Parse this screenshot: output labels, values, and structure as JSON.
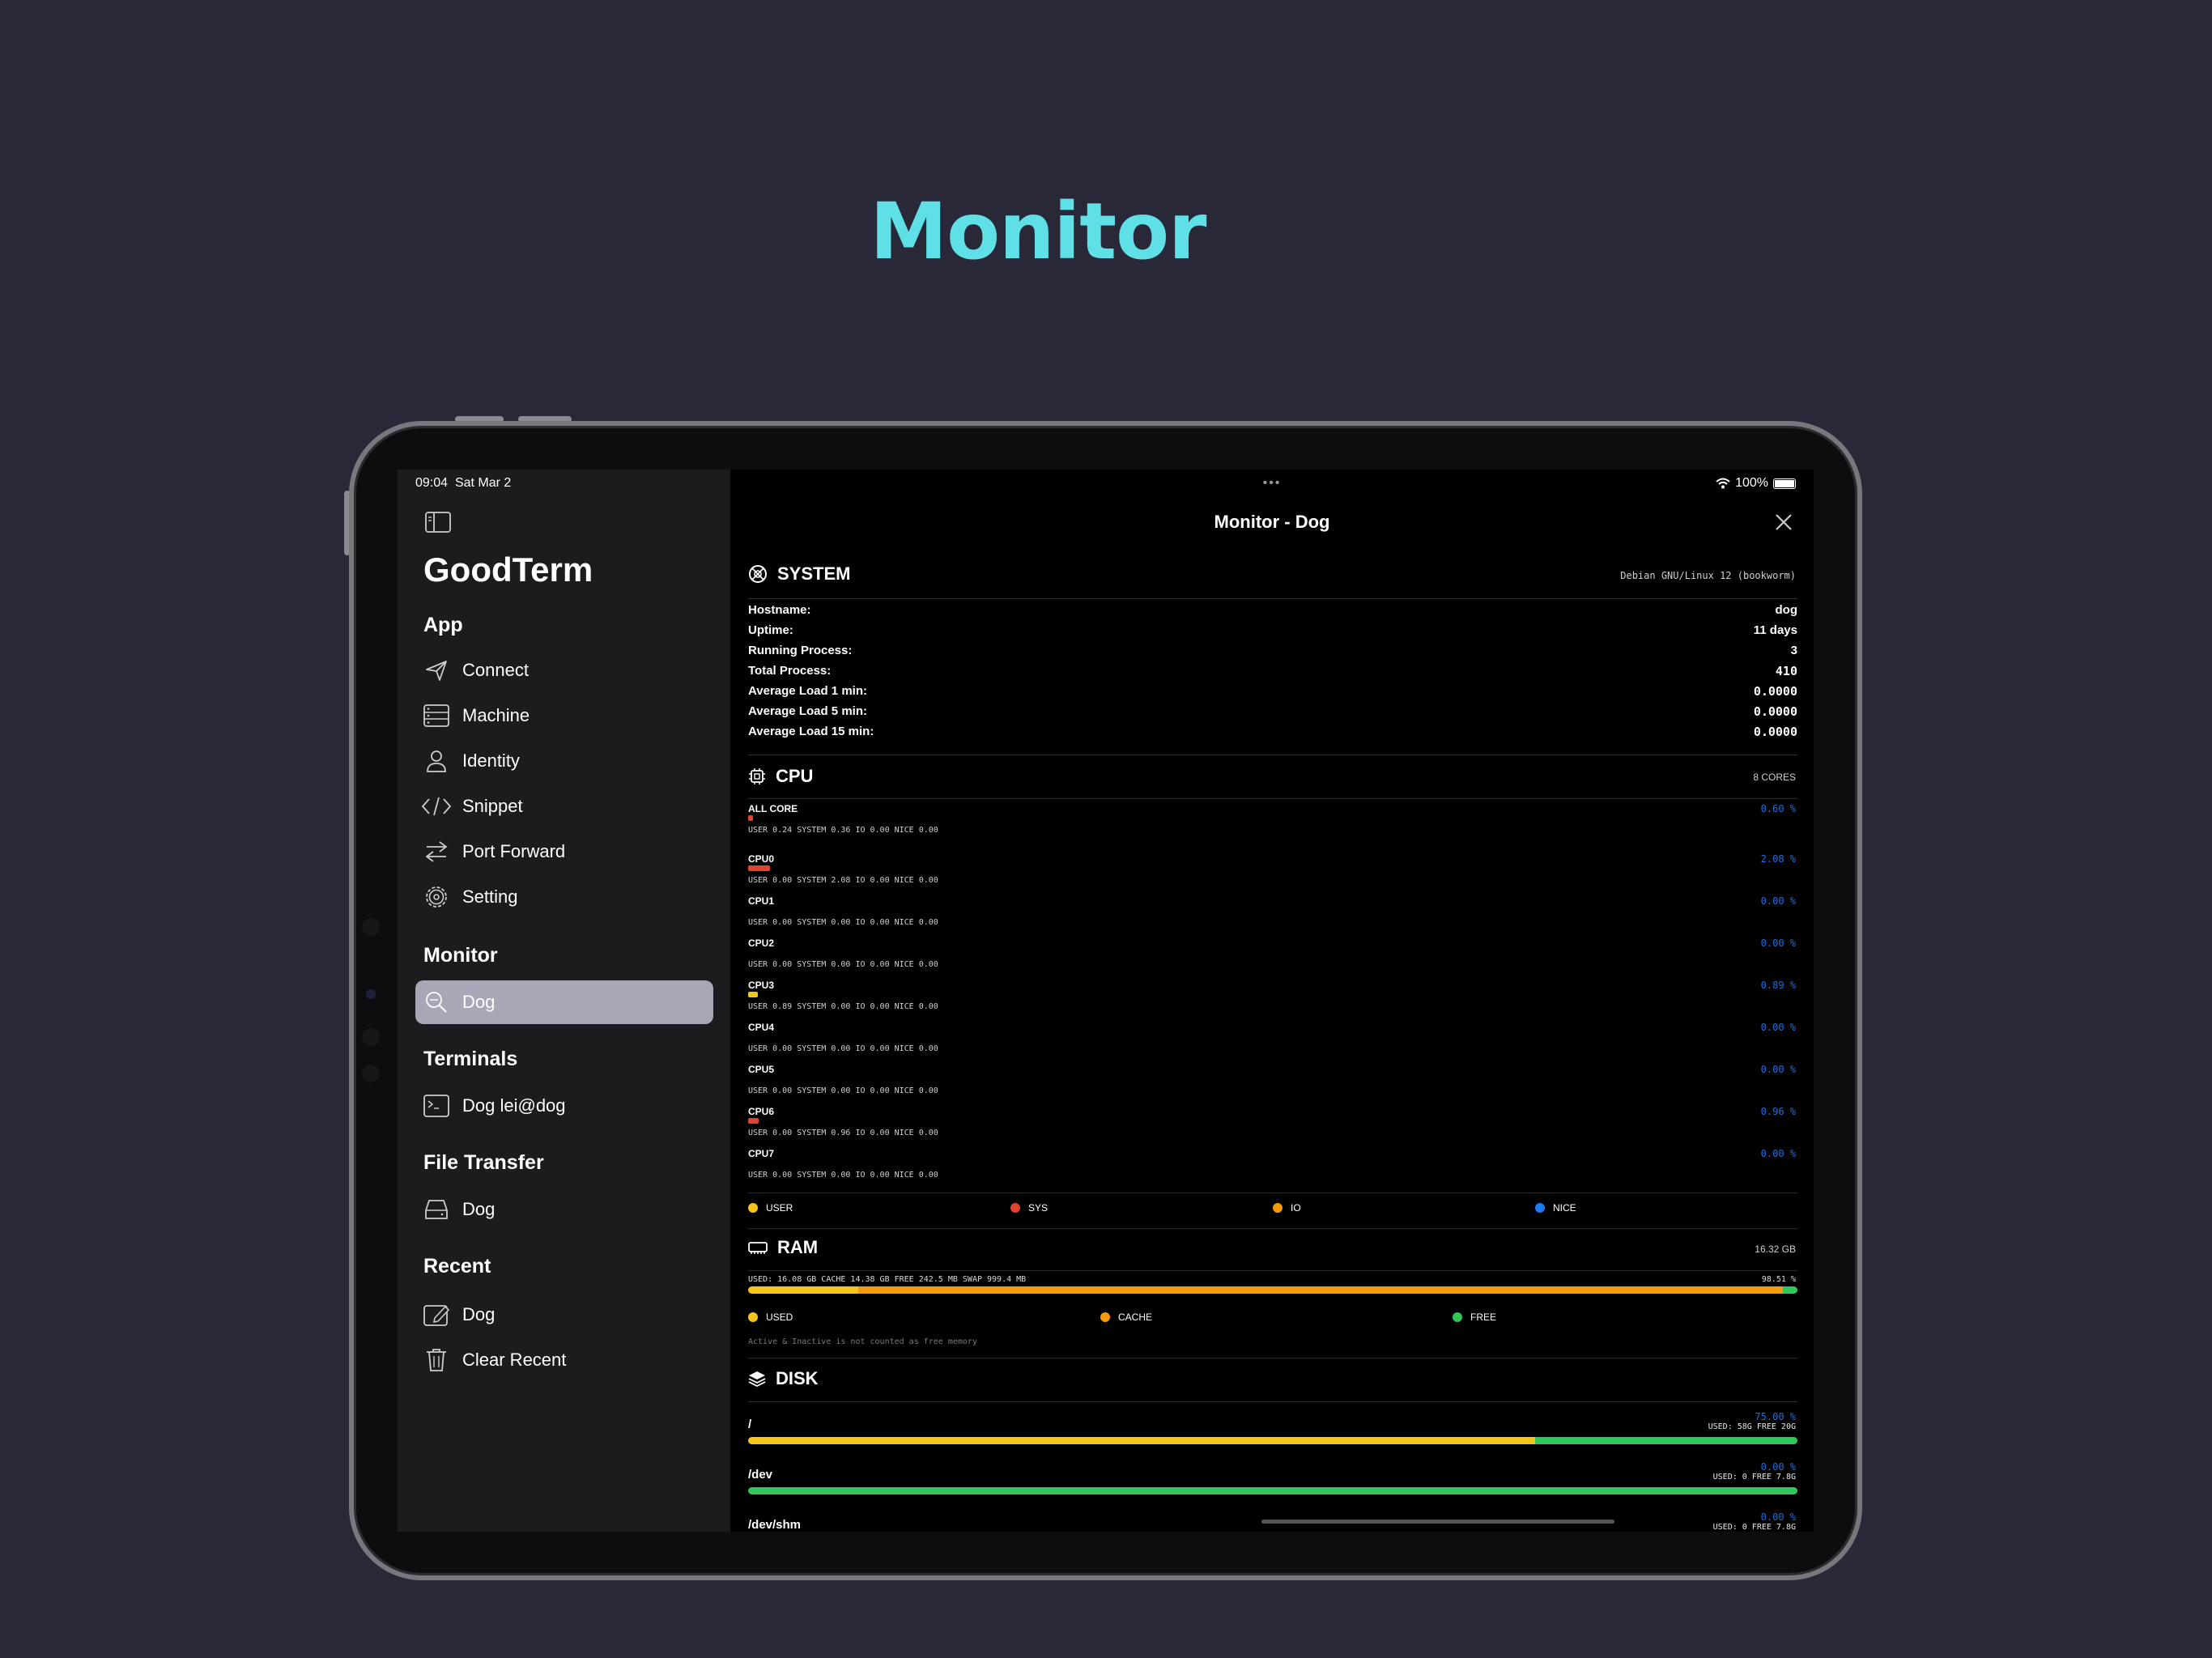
{
  "hero": {
    "title": "Monitor"
  },
  "status": {
    "time": "09:04",
    "date": "Sat Mar 2",
    "battery": "100%"
  },
  "sidebar": {
    "app_title": "GoodTerm",
    "sections": {
      "app": "App",
      "monitor": "Monitor",
      "terminals": "Terminals",
      "file_transfer": "File Transfer",
      "recent": "Recent"
    },
    "app_items": [
      {
        "label": "Connect",
        "icon": "paper-plane-icon"
      },
      {
        "label": "Machine",
        "icon": "server-icon"
      },
      {
        "label": "Identity",
        "icon": "person-icon"
      },
      {
        "label": "Snippet",
        "icon": "code-icon"
      },
      {
        "label": "Port Forward",
        "icon": "arrows-left-right-icon"
      },
      {
        "label": "Setting",
        "icon": "gear-icon"
      }
    ],
    "monitor_items": [
      {
        "label": "Dog",
        "icon": "magnifier-icon",
        "active": true
      }
    ],
    "terminal_items": [
      {
        "label": "Dog lei@dog",
        "icon": "terminal-icon"
      }
    ],
    "file_items": [
      {
        "label": "Dog",
        "icon": "hard-drive-icon"
      }
    ],
    "recent_items": [
      {
        "label": "Dog",
        "icon": "edit-icon"
      },
      {
        "label": "Clear Recent",
        "icon": "trash-icon"
      }
    ]
  },
  "main": {
    "dots": "•••",
    "title": "Monitor - Dog",
    "system": {
      "title": "SYSTEM",
      "os": "Debian GNU/Linux 12 (bookworm)",
      "rows": [
        {
          "k": "Hostname:",
          "v": "dog"
        },
        {
          "k": "Uptime:",
          "v": "11 days"
        },
        {
          "k": "Running Process:",
          "v": "3"
        },
        {
          "k": "Total Process:",
          "v": "410"
        },
        {
          "k": "Average Load 1 min:",
          "v": "0.0000"
        },
        {
          "k": "Average Load 5 min:",
          "v": "0.0000"
        },
        {
          "k": "Average Load 15 min:",
          "v": "0.0000"
        }
      ]
    },
    "cpu": {
      "title": "CPU",
      "cores": "8 CORES",
      "rows": [
        {
          "name": "ALL CORE",
          "pct": "0.60 %",
          "detail": "USER 0.24 SYSTEM 0.36 IO 0.00 NICE 0.00",
          "bar_color": "#e0442f",
          "bar_frac": 0.005
        },
        {
          "name": "CPU0",
          "pct": "2.08 %",
          "detail": "USER 0.00 SYSTEM 2.08 IO 0.00 NICE 0.00",
          "bar_color": "#e0442f",
          "bar_frac": 0.021
        },
        {
          "name": "CPU1",
          "pct": "0.00 %",
          "detail": "USER 0.00 SYSTEM 0.00 IO 0.00 NICE 0.00",
          "bar_color": "#e0442f",
          "bar_frac": 0
        },
        {
          "name": "CPU2",
          "pct": "0.00 %",
          "detail": "USER 0.00 SYSTEM 0.00 IO 0.00 NICE 0.00",
          "bar_color": "#e0442f",
          "bar_frac": 0
        },
        {
          "name": "CPU3",
          "pct": "0.89 %",
          "detail": "USER 0.89 SYSTEM 0.00 IO 0.00 NICE 0.00",
          "bar_color": "#f5c518",
          "bar_frac": 0.009
        },
        {
          "name": "CPU4",
          "pct": "0.00 %",
          "detail": "USER 0.00 SYSTEM 0.00 IO 0.00 NICE 0.00",
          "bar_color": "#e0442f",
          "bar_frac": 0
        },
        {
          "name": "CPU5",
          "pct": "0.00 %",
          "detail": "USER 0.00 SYSTEM 0.00 IO 0.00 NICE 0.00",
          "bar_color": "#e0442f",
          "bar_frac": 0
        },
        {
          "name": "CPU6",
          "pct": "0.96 %",
          "detail": "USER 0.00 SYSTEM 0.96 IO 0.00 NICE 0.00",
          "bar_color": "#e0442f",
          "bar_frac": 0.01
        },
        {
          "name": "CPU7",
          "pct": "0.00 %",
          "detail": "USER 0.00 SYSTEM 0.00 IO 0.00 NICE 0.00",
          "bar_color": "#e0442f",
          "bar_frac": 0
        }
      ],
      "legend": [
        {
          "label": "USER",
          "color": "#f5c518"
        },
        {
          "label": "SYS",
          "color": "#e0442f"
        },
        {
          "label": "IO",
          "color": "#f59a0b"
        },
        {
          "label": "NICE",
          "color": "#1a7cf0"
        }
      ]
    },
    "ram": {
      "title": "RAM",
      "total": "16.32 GB",
      "summary": "USED: 16.08 GB CACHE 14.38 GB FREE 242.5 MB SWAP 999.4 MB",
      "pct": "98.51 %",
      "used_frac": 0.105,
      "cache_frac": 0.881,
      "free_frac": 0.014,
      "legend": [
        {
          "label": "USED",
          "color": "#f5c518"
        },
        {
          "label": "CACHE",
          "color": "#f59a0b"
        },
        {
          "label": "FREE",
          "color": "#2fc65a"
        }
      ],
      "note": "Active & Inactive is not counted as free memory"
    },
    "disk": {
      "title": "DISK",
      "items": [
        {
          "name": "/",
          "pct": "75.00 %",
          "info": "USED: 58G FREE 20G",
          "used_frac": 0.75
        },
        {
          "name": "/dev",
          "pct": "0.00 %",
          "info": "USED: 0 FREE 7.8G",
          "used_frac": 0
        },
        {
          "name": "/dev/shm",
          "pct": "0.00 %",
          "info": "USED: 0 FREE 7.8G",
          "used_frac": 0
        }
      ],
      "used_color": "#f5c518",
      "free_color": "#2fc65a"
    }
  }
}
